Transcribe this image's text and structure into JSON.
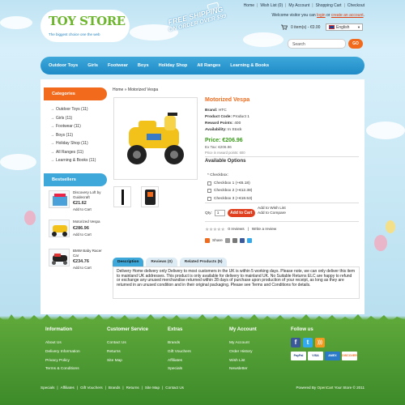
{
  "header": {
    "top_links": [
      "Home",
      "Wish List (0)",
      "My Account",
      "Shopping Cart",
      "Checkout"
    ],
    "welcome_prefix": "Welcome visitor you can",
    "login_label": "login",
    "or_label": "or",
    "create_label": "create an account",
    "welcome_suffix": ".",
    "logo_title": "TOY STORE",
    "logo_tagline": "The biggest choice one the web",
    "shipping_line1": "FREE SHIPPING",
    "shipping_line2": "ON ORDER OVER $99",
    "cart_summary": "0 item(s) - €0.00",
    "language": "English",
    "search_placeholder": "Search",
    "go_label": "GO"
  },
  "nav": {
    "items": [
      "Outdoor Toys",
      "Girls",
      "Footwear",
      "Boys",
      "Holiday Shop",
      "All Ranges",
      "Learning & Books"
    ]
  },
  "sidebar": {
    "categories_title": "Categories",
    "categories": [
      "Outdoor Toys (11)",
      "Girls (11)",
      "Footwear (11)",
      "Boys (11)",
      "Holiday Shop (11)",
      "All Ranges (11)",
      "Learning & Books (11)"
    ],
    "bestsellers_title": "Bestsellers",
    "bestsellers": [
      {
        "name": "Discovery Loft by Guidecraft",
        "price": "€21.62",
        "cart": "Add to Cart"
      },
      {
        "name": "Motorized Vespa",
        "price": "€286.96",
        "cart": "Add to Cart"
      },
      {
        "name": "BMW Baby Racer Car",
        "price": "€234.76",
        "cart": "Add to Cart"
      }
    ]
  },
  "breadcrumb": {
    "home": "Home",
    "sep": "»",
    "current": "Motorized Vespa"
  },
  "product": {
    "title": "Motorized Vespa",
    "brand_label": "Brand:",
    "brand": "HTC",
    "code_label": "Product Code:",
    "code": "Product 1",
    "reward_label": "Reward Points:",
    "reward": "400",
    "avail_label": "Availability:",
    "avail": "In Stock",
    "price": "Price: €206.96",
    "ex_tax": "Ex Tax: €206.96",
    "reward_note": "Price in reward points: 600",
    "options_title": "Available Options",
    "checkbox_label": "* Checkbox:",
    "checkboxes": [
      "Checkbox 1 (+€6.18)",
      "Checkbox 2 (+€12.38)",
      "Checkbox 3 (+€18.53)"
    ],
    "qty_label": "Qty:",
    "qty_value": "1",
    "add_to_cart": "Add to Cart",
    "wishlist": "Add to Wish List",
    "compare": "Add to Compare",
    "reviews": "0 reviews",
    "write_review": "Write a review",
    "share": "Share"
  },
  "tabs": [
    "Description",
    "Reviews (0)",
    "Related Products (5)"
  ],
  "description": "Delivery Home delivery only Delivery to most customers in the UK is within 5 working days. Please note, we can only deliver this item to mainland UK addresses. This product is only available for delivery to mainland UK. No Suitable Returns ELC are happy to refund or exchange any unused merchandise returned within 28 days of purchase upon production of your receipt, as long as they are returned in an unused condition and in their original packaging. Please see Terms and Conditions for details.",
  "footer": {
    "columns": [
      {
        "title": "Information",
        "links": [
          "About Us",
          "Delivery Information",
          "Privacy Policy",
          "Terms & Conditions"
        ]
      },
      {
        "title": "Customer Service",
        "links": [
          "Contact Us",
          "Returns",
          "Site Map"
        ]
      },
      {
        "title": "Extras",
        "links": [
          "Brands",
          "Gift Vouchers",
          "Affiliates",
          "Specials"
        ]
      },
      {
        "title": "My Account",
        "links": [
          "My Account",
          "Order History",
          "Wish List",
          "Newsletter"
        ]
      }
    ],
    "follow_title": "Follow us",
    "payments": [
      "PayPal",
      "VISA",
      "AMEX",
      "DISCOVER"
    ],
    "bottom_links": [
      "Specials",
      "Affiliates",
      "Gift Vouchers",
      "Brands",
      "Returns",
      "Site Map",
      "Contact Us"
    ],
    "powered_prefix": "Powered By",
    "powered_link": "OpenCart",
    "powered_suffix": "Your Store © 2011"
  },
  "colors": {
    "accent": "#f26a1b",
    "nav": "#3ea8da",
    "price": "#3b9a1c",
    "grass": "#3d8a2a"
  }
}
